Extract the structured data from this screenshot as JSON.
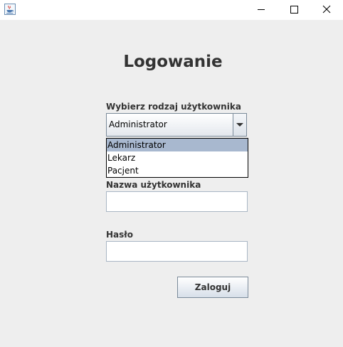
{
  "window": {
    "app_icon": "java-coffee-cup-icon",
    "controls": {
      "minimize_icon": "minimize-icon",
      "maximize_icon": "maximize-icon",
      "close_icon": "close-icon"
    }
  },
  "form": {
    "title": "Logowanie",
    "user_type_label": "Wybierz rodzaj użytkownika",
    "user_type_selected": "Administrator",
    "user_type_options": [
      "Administrator",
      "Lekarz",
      "Pacjent"
    ],
    "username_label": "Nazwa użytkownika",
    "username_value": "",
    "password_label": "Hasło",
    "password_value": "",
    "login_button": "Zaloguj"
  },
  "colors": {
    "background": "#eeeeee",
    "selection": "#a8b8cf",
    "text": "#333333"
  }
}
